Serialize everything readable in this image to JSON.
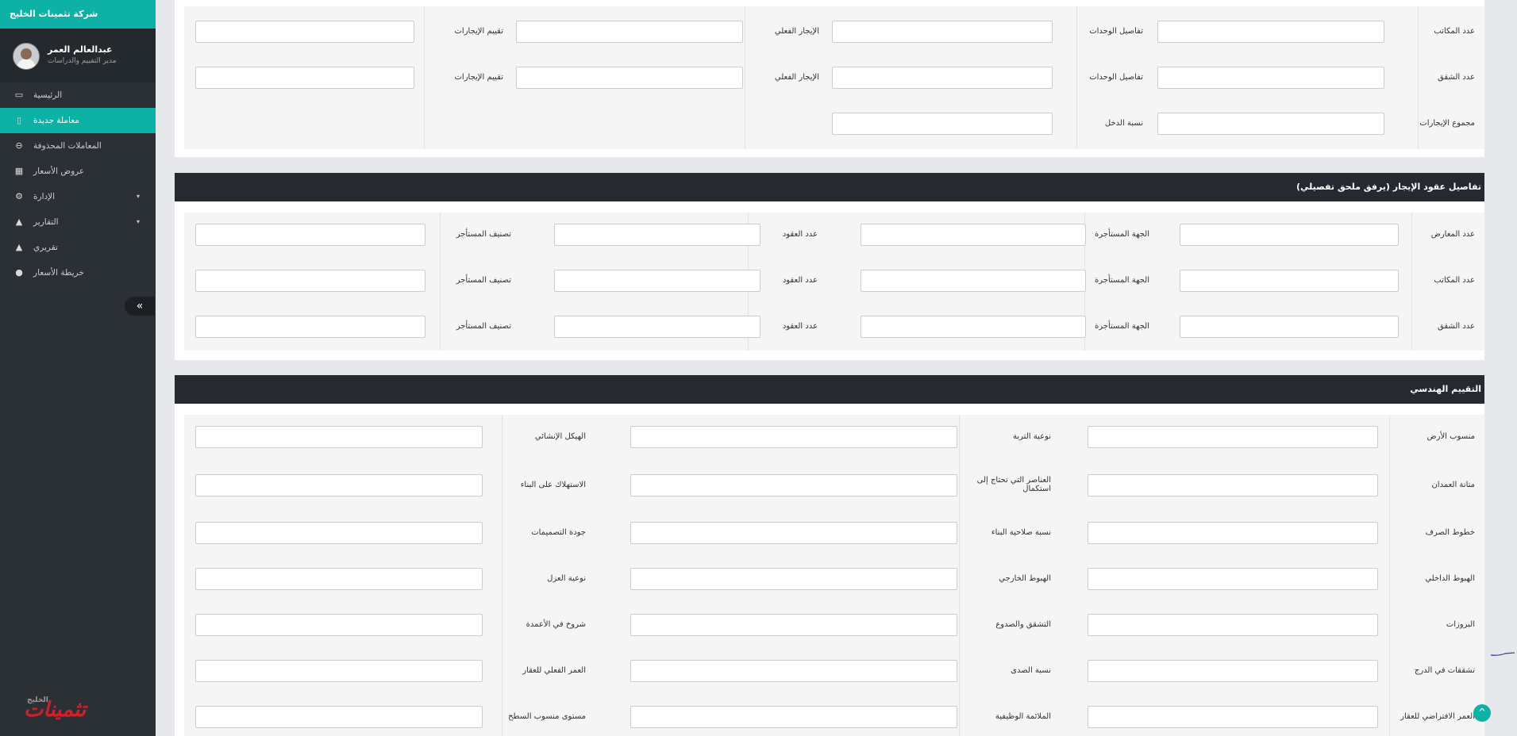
{
  "sidebar": {
    "brand": "شركة تثمينات الخليج",
    "user": {
      "name": "عبدالعالم العمر",
      "role": "مدير التقييم والدراسات"
    },
    "items": [
      {
        "label": "الرئيسية",
        "icon": "laptop-icon"
      },
      {
        "label": "معاملة جديدة",
        "icon": "file-icon",
        "active": true
      },
      {
        "label": "المعاملات المحذوفة",
        "icon": "minus-circle-icon"
      },
      {
        "label": "عروض الأسعار",
        "icon": "gift-icon"
      },
      {
        "label": "الإدارة",
        "icon": "cogs-icon",
        "has_caret": true
      },
      {
        "label": "التقارير",
        "icon": "area-chart-icon",
        "has_caret": true
      },
      {
        "label": "تقريري",
        "icon": "area-chart-icon"
      },
      {
        "label": "خريطة الأسعار",
        "icon": "map-marker-icon"
      }
    ],
    "collapse_glyph": "«",
    "logo_text": "تثمينات",
    "logo_sub": "الخليج"
  },
  "section_top": {
    "rows": [
      {
        "label": "عدد المكاتب",
        "f1": "تفاصيل الوحدات",
        "f2": "الإيجار الفعلي",
        "f3": "تقييم الإيجارات"
      },
      {
        "label": "عدد الشقق",
        "f1": "تفاصيل الوحدات",
        "f2": "الإيجار الفعلي",
        "f3": "تقييم الإيجارات"
      },
      {
        "label": "مجموع الإيجارات",
        "f1": "نسبة الدخل"
      }
    ]
  },
  "section_leases": {
    "title": "تفاصيل عقود الإيجار (يرفق ملحق تفصيلي)",
    "rows": [
      {
        "label": "عدد المعارض",
        "f1": "الجهة المستأجرة",
        "f2": "عدد العقود",
        "f3": "تصنيف المستأجر"
      },
      {
        "label": "عدد المكاتب",
        "f1": "الجهة المستأجرة",
        "f2": "عدد العقود",
        "f3": "تصنيف المستأجر"
      },
      {
        "label": "عدد الشقق",
        "f1": "الجهة المستأجرة",
        "f2": "عدد العقود",
        "f3": "تصنيف المستأجر"
      }
    ]
  },
  "section_engineering": {
    "title": "التقييم الهندسي",
    "rows": [
      {
        "label": "منسوب الأرض",
        "f1": "نوعية التربة",
        "f2": "الهيكل الإنشائي"
      },
      {
        "label": "متانة العمدان",
        "f1": "العناصر التي تحتاج إلى استكمال",
        "f2": "الاستهلاك على البناء"
      },
      {
        "label": "خطوط الصرف",
        "f1": "نسبة صلاحية البناء",
        "f2": "جودة التصميمات"
      },
      {
        "label": "الهبوط الداخلي",
        "f1": "الهبوط الخارجي",
        "f2": "نوعية العزل"
      },
      {
        "label": "البروزات",
        "f1": "التشقق والصدوع",
        "f2": "شروخ في الأعمدة"
      },
      {
        "label": "تشققات في الدرج",
        "f1": "نسبة الصدى",
        "f2": "العمر الفعلي للعقار"
      },
      {
        "label": "العمر الافتراضي للعقار",
        "f1": "الملائمة الوظيفية",
        "f2": "مستوى منسوب السطح"
      }
    ]
  },
  "fab_glyph": "^",
  "colors": {
    "accent": "#0eb1a5",
    "sidebar": "#2b3035",
    "panel_head": "#262a30"
  }
}
